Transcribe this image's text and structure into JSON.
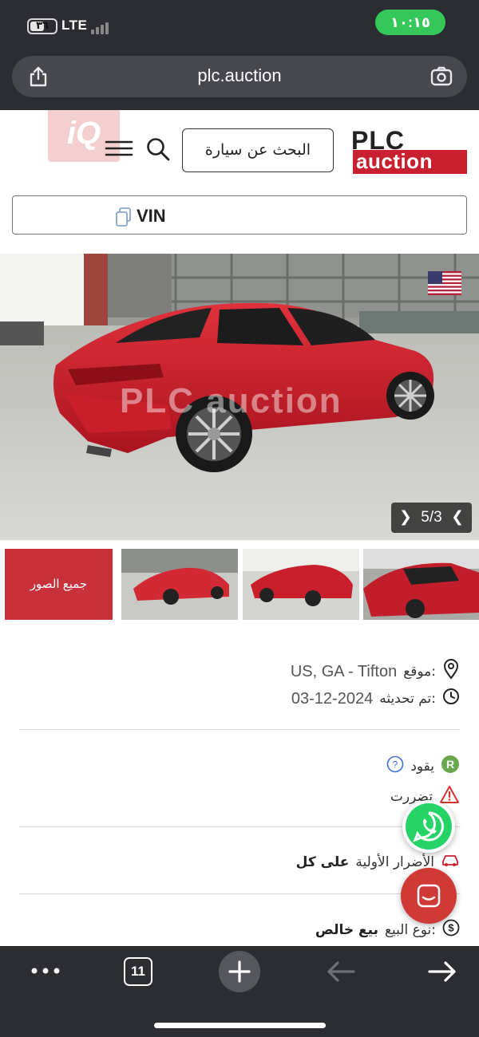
{
  "status_bar": {
    "battery_level": "٣٦",
    "network": "LTE",
    "time": "١٠:١٥"
  },
  "browser": {
    "url": "plc.auction",
    "tab_count": "11"
  },
  "header": {
    "search_button_label": "البحث عن سيارة",
    "logo_top": "PLC",
    "logo_bottom": "auction",
    "iq_logo": "iQ"
  },
  "vin": {
    "label": "VIN"
  },
  "gallery": {
    "counter": "5/3",
    "watermark": "PLC auction",
    "all_photos_label": "جميع الصور",
    "flag_country": "US"
  },
  "details": {
    "location_label": "موقع:",
    "location_value": "US, GA - Tifton",
    "updated_label": "تم تحديثه:",
    "updated_value": "03-12-2024",
    "runs_label": "يقود",
    "damaged_label": "تضررت",
    "primary_damage_label": "الأضرار الأولية",
    "primary_damage_value": "على كل",
    "sale_type_label": "نوع البيع:",
    "sale_type_value": "بيع خالص"
  },
  "colors": {
    "brand_red": "#c8202e",
    "status_green": "#35c759",
    "runs_badge_green": "#6aa84f",
    "whatsapp_green": "#25d366"
  }
}
